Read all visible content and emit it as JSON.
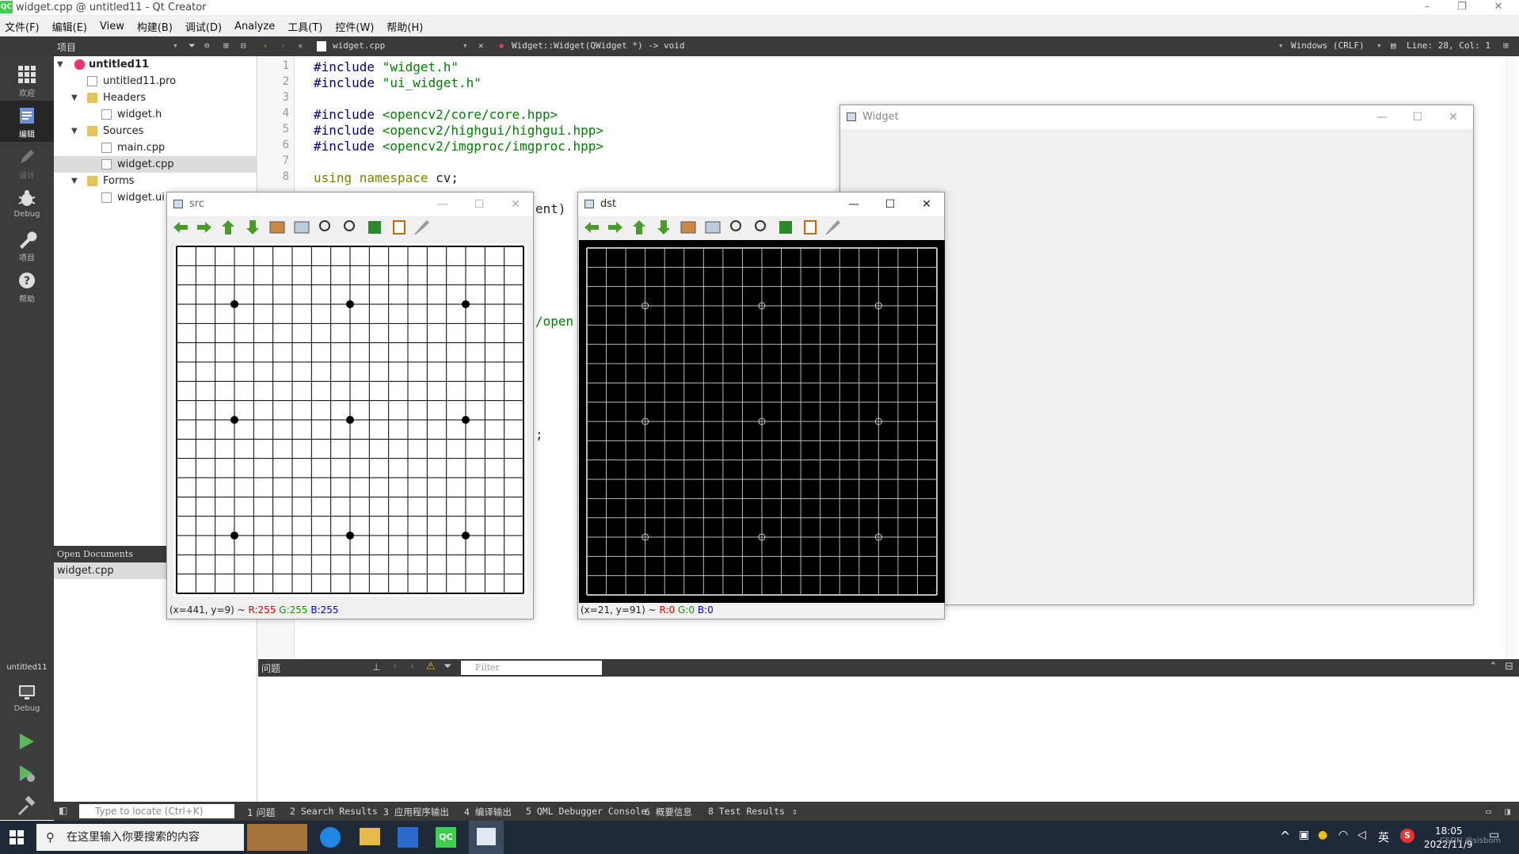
{
  "titlebar": {
    "title": "widget.cpp @ untitled11 - Qt Creator",
    "app_badge": "QC"
  },
  "menu": [
    "文件(F)",
    "编辑(E)",
    "View",
    "构建(B)",
    "调试(D)",
    "Analyze",
    "工具(T)",
    "控件(W)",
    "帮助(H)"
  ],
  "toolstrip": {
    "panel_label": "项目",
    "file": "widget.cpp",
    "function": "Widget::Widget(QWidget *) -> void",
    "encoding": "Windows (CRLF)",
    "position": "Line: 28, Col: 1"
  },
  "modes": [
    {
      "label": "欢迎",
      "icon": "grid-icon"
    },
    {
      "label": "编辑",
      "icon": "edit-icon"
    },
    {
      "label": "设计",
      "icon": "pencil-icon"
    },
    {
      "label": "Debug",
      "icon": "bug-icon"
    },
    {
      "label": "项目",
      "icon": "wrench-icon"
    },
    {
      "label": "帮助",
      "icon": "help-icon"
    }
  ],
  "kit": {
    "project": "untitled11",
    "config": "Debug"
  },
  "tree": {
    "root": "untitled11",
    "pro": "untitled11.pro",
    "headers": "Headers",
    "header_file": "widget.h",
    "sources": "Sources",
    "src1": "main.cpp",
    "src2": "widget.cpp",
    "forms": "Forms",
    "form_file": "widget.ui"
  },
  "open_documents": {
    "header": "Open Documents",
    "doc": "widget.cpp"
  },
  "code": {
    "line_numbers": [
      "1",
      "2",
      "3",
      "4",
      "5",
      "6",
      "7",
      "8"
    ],
    "l1_a": "#include ",
    "l1_b": "\"widget.h\"",
    "l2_a": "#include ",
    "l2_b": "\"ui_widget.h\"",
    "l4_a": "#include ",
    "l4_b": "<opencv2/core/core.hpp>",
    "l5_a": "#include ",
    "l5_b": "<opencv2/highgui/highgui.hpp>",
    "l6_a": "#include ",
    "l6_b": "<opencv2/imgproc/imgproc.hpp>",
    "l8_a": "using ",
    "l8_b": "namespace ",
    "l8_c": "cv;",
    "frag1": "ent)",
    "frag2": "/open",
    "frag3": ";"
  },
  "issues": {
    "title": "问题",
    "filter_placeholder": "Filter"
  },
  "status": {
    "locate_placeholder": "Type to locate (Ctrl+K)",
    "tabs": [
      "1 问题",
      "2 Search Results",
      "3 应用程序输出",
      "4 编译输出",
      "5 QML Debugger Console",
      "6 概要信息",
      "8 Test Results"
    ]
  },
  "widget_window": {
    "title": "Widget"
  },
  "src_window": {
    "title": "src",
    "status_prefix": "(x=441, y=9) ~ ",
    "r": "R:255",
    "g": "G:255",
    "b": "B:255"
  },
  "dst_window": {
    "title": "dst",
    "status_prefix": "(x=21, y=91) ~ ",
    "r": "R:0",
    "g": "G:0",
    "b": "B:0"
  },
  "taskbar": {
    "search_placeholder": "在这里输入你要搜索的内容",
    "time": "18:05",
    "date": "2022/11/9",
    "ime": "英",
    "watermark": "CSDN @sisbom"
  },
  "colors": {
    "accent_green": "#41cd52",
    "dark_panel": "#3a3a3a",
    "r": "#e00000",
    "g": "#00a000",
    "b": "#0000e0"
  }
}
